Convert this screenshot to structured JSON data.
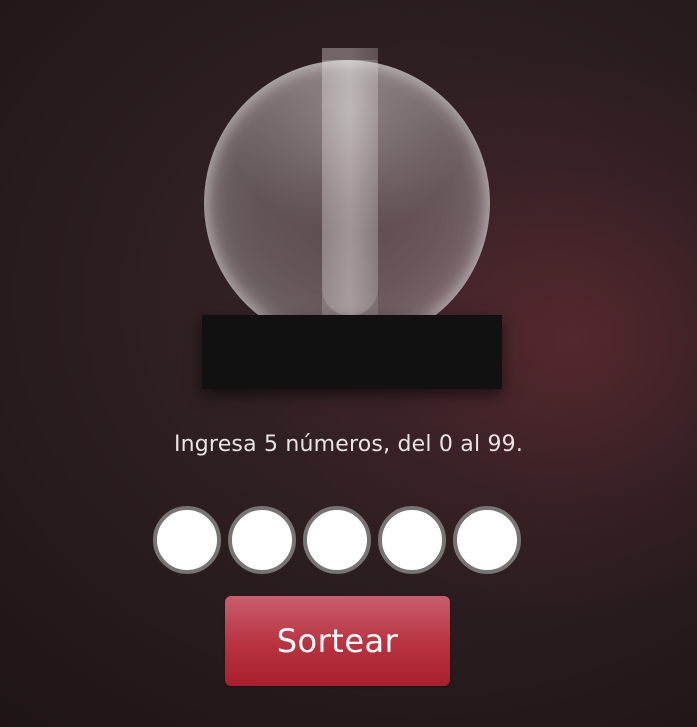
{
  "instructions": {
    "text": "Ingresa 5 números, del 0 al 99."
  },
  "inputs": {
    "values": [
      "",
      "",
      "",
      "",
      ""
    ]
  },
  "actions": {
    "draw_label": "Sortear"
  },
  "colors": {
    "button": "#b8323f",
    "input_border": "#777474",
    "machine_base": "#111111"
  }
}
